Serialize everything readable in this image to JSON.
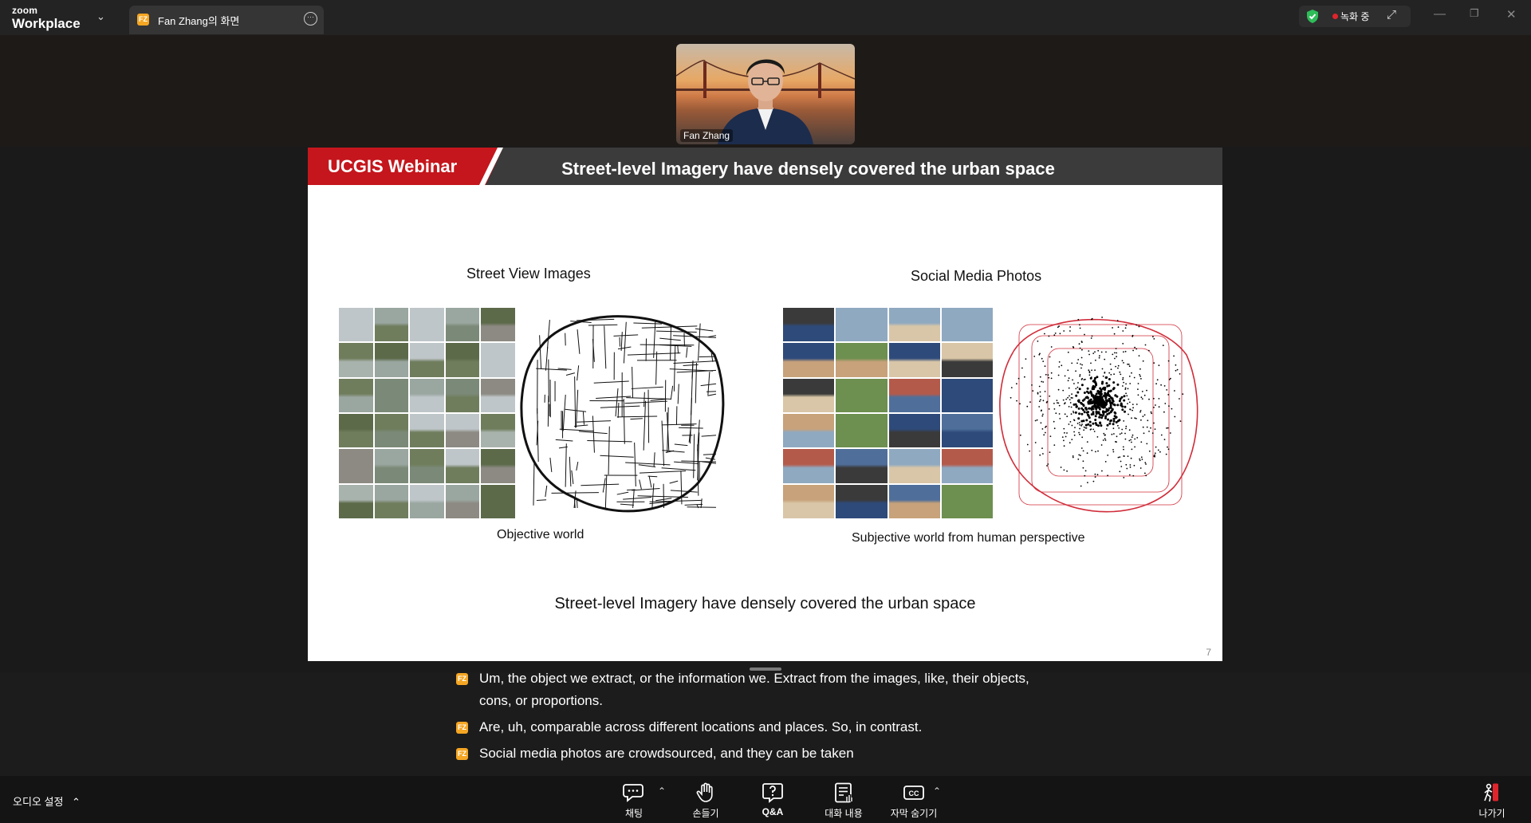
{
  "app": {
    "logo_line1": "zoom",
    "logo_line2": "Workplace"
  },
  "tab": {
    "avatar": "FZ",
    "title": "Fan Zhang의 화면"
  },
  "recording": {
    "label": "녹화 중"
  },
  "colors": {
    "accent_red": "#c4161c",
    "avatar_orange": "#f5a623",
    "record_dot": "#e0242c",
    "shield_green": "#2ebd59"
  },
  "participant": {
    "name": "Fan Zhang"
  },
  "slide": {
    "brand": "UCGIS Webinar",
    "title": "Street-level Imagery have densely covered the urban space",
    "left_section": "Street View Images",
    "right_section": "Social Media Photos",
    "left_caption": "Objective world",
    "right_caption": "Subjective world from human perspective",
    "bottom_caption": "Street-level Imagery have densely covered the urban space",
    "page_number": "7"
  },
  "captions": [
    {
      "avatar": "FZ",
      "text": "Um, the object we extract, or the information we. Extract from the images, like, their objects,"
    },
    {
      "avatar": "",
      "text": "cons, or proportions."
    },
    {
      "avatar": "FZ",
      "text": "Are, uh, comparable across different locations and places. So, in contrast."
    },
    {
      "avatar": "FZ",
      "text": "Social media photos are crowdsourced, and they can be taken"
    }
  ],
  "toolbar": {
    "audio_settings": "오디오 설정",
    "chat": "채팅",
    "raise_hand": "손들기",
    "qa": "Q&A",
    "transcript": "대화 내용",
    "hide_captions": "자막 숨기기",
    "leave": "나가기"
  }
}
